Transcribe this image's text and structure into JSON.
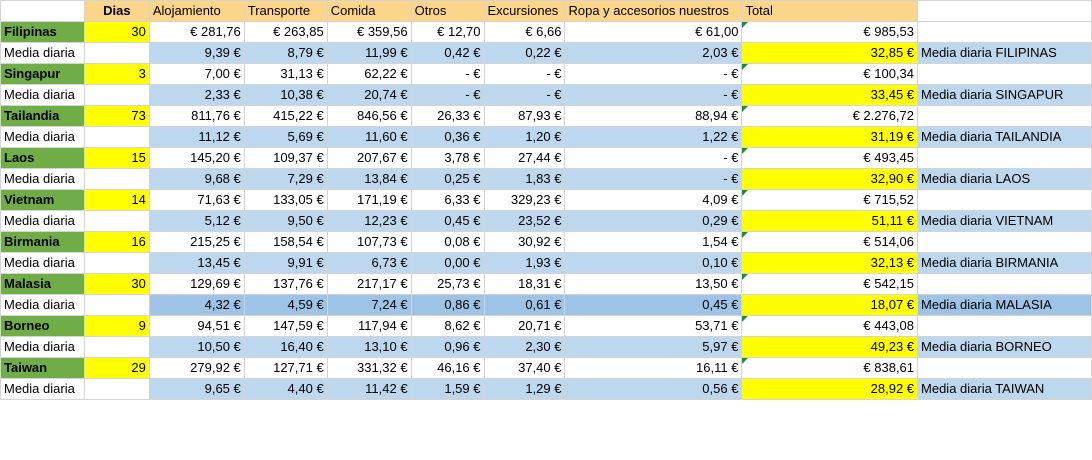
{
  "headers": {
    "col_country": "",
    "col_dias": "Dias",
    "col_alojamiento": "Alojamiento",
    "col_transporte": "Transporte",
    "col_comida": "Comida",
    "col_otros": "Otros",
    "col_excursiones": "Excursiones",
    "col_ropa": "Ropa y accesorios nuestros",
    "col_total": "Total"
  },
  "rows": [
    {
      "name": "Filipinas",
      "dias": "30",
      "aloj": "€ 281,76",
      "trans": "€ 263,85",
      "comida": "€ 359,56",
      "otros": "€ 12,70",
      "exc": "€ 6,66",
      "ropa": "€ 61,00",
      "total": "€ 985,53",
      "avg_label": "Media diaria",
      "avg_aloj": "9,39 €",
      "avg_trans": "8,79 €",
      "avg_comida": "11,99 €",
      "avg_otros": "0,42 €",
      "avg_exc": "0,22 €",
      "avg_ropa": "2,03 €",
      "avg_total": "32,85 €",
      "avg_name": "Media diaria FILIPINAS"
    },
    {
      "name": "Singapur",
      "dias": "3",
      "aloj": "7,00 €",
      "trans": "31,13 €",
      "comida": "62,22 €",
      "otros": "-    €",
      "exc": "-    €",
      "ropa": "-    €",
      "total": "€ 100,34",
      "avg_label": "Media diaria",
      "avg_aloj": "2,33 €",
      "avg_trans": "10,38 €",
      "avg_comida": "20,74 €",
      "avg_otros": "-    €",
      "avg_exc": "-    €",
      "avg_ropa": "-    €",
      "avg_total": "33,45 €",
      "avg_name": "Media diaria SINGAPUR"
    },
    {
      "name": "Tailandia",
      "dias": "73",
      "aloj": "811,76 €",
      "trans": "415,22 €",
      "comida": "846,56 €",
      "otros": "26,33 €",
      "exc": "87,93 €",
      "ropa": "88,94 €",
      "total": "€ 2.276,72",
      "avg_label": "Media diaria",
      "avg_aloj": "11,12 €",
      "avg_trans": "5,69 €",
      "avg_comida": "11,60 €",
      "avg_otros": "0,36 €",
      "avg_exc": "1,20 €",
      "avg_ropa": "1,22 €",
      "avg_total": "31,19 €",
      "avg_name": "Media diaria TAILANDIA"
    },
    {
      "name": "Laos",
      "dias": "15",
      "aloj": "145,20 €",
      "trans": "109,37 €",
      "comida": "207,67 €",
      "otros": "3,78 €",
      "exc": "27,44 €",
      "ropa": "-    €",
      "total": "€ 493,45",
      "avg_label": "Media diaria",
      "avg_aloj": "9,68 €",
      "avg_trans": "7,29 €",
      "avg_comida": "13,84 €",
      "avg_otros": "0,25 €",
      "avg_exc": "1,83 €",
      "avg_ropa": "-    €",
      "avg_total": "32,90 €",
      "avg_name": "Media diaria LAOS"
    },
    {
      "name": "Vietnam",
      "dias": "14",
      "aloj": "71,63 €",
      "trans": "133,05 €",
      "comida": "171,19 €",
      "otros": "6,33 €",
      "exc": "329,23 €",
      "ropa": "4,09 €",
      "total": "€ 715,52",
      "avg_label": "Media diaria",
      "avg_aloj": "5,12 €",
      "avg_trans": "9,50 €",
      "avg_comida": "12,23 €",
      "avg_otros": "0,45 €",
      "avg_exc": "23,52 €",
      "avg_ropa": "0,29 €",
      "avg_total": "51,11 €",
      "avg_name": "Media diaria VIETNAM"
    },
    {
      "name": "Birmania",
      "dias": "16",
      "aloj": "215,25 €",
      "trans": "158,54 €",
      "comida": "107,73 €",
      "otros": "0,08 €",
      "exc": "30,92 €",
      "ropa": "1,54 €",
      "total": "€ 514,06",
      "avg_label": "Media diaria",
      "avg_aloj": "13,45 €",
      "avg_trans": "9,91 €",
      "avg_comida": "6,73 €",
      "avg_otros": "0,00 €",
      "avg_exc": "1,93 €",
      "avg_ropa": "0,10 €",
      "avg_total": "32,13 €",
      "avg_name": "Media diaria BIRMANIA"
    },
    {
      "name": "Malasia",
      "dias": "30",
      "aloj": "129,69 €",
      "trans": "137,76 €",
      "comida": "217,17 €",
      "otros": "25,73 €",
      "exc": "18,31 €",
      "ropa": "13,50 €",
      "total": "€ 542,15",
      "avg_label": "Media diaria",
      "avg_aloj": "4,32 €",
      "avg_trans": "4,59 €",
      "avg_comida": "7,24 €",
      "avg_otros": "0,86 €",
      "avg_exc": "0,61 €",
      "avg_ropa": "0,45 €",
      "avg_total": "18,07 €",
      "avg_name": "Media diaria MALASIA"
    },
    {
      "name": "Borneo",
      "dias": "9",
      "aloj": "94,51 €",
      "trans": "147,59 €",
      "comida": "117,94 €",
      "otros": "8,62 €",
      "exc": "20,71 €",
      "ropa": "53,71 €",
      "total": "€ 443,08",
      "avg_label": "Media diaria",
      "avg_aloj": "10,50 €",
      "avg_trans": "16,40 €",
      "avg_comida": "13,10 €",
      "avg_otros": "0,96 €",
      "avg_exc": "2,30 €",
      "avg_ropa": "5,97 €",
      "avg_total": "49,23 €",
      "avg_name": "Media diaria BORNEO"
    },
    {
      "name": "Taiwan",
      "dias": "29",
      "aloj": "279,92 €",
      "trans": "127,71 €",
      "comida": "331,32 €",
      "otros": "46,16 €",
      "exc": "37,40 €",
      "ropa": "16,11 €",
      "total": "€ 838,61",
      "avg_label": "Media diaria",
      "avg_aloj": "9,65 €",
      "avg_trans": "4,40 €",
      "avg_comida": "11,42 €",
      "avg_otros": "1,59 €",
      "avg_exc": "1,29 €",
      "avg_ropa": "0,56 €",
      "avg_total": "28,92 €",
      "avg_name": "Media diaria TAIWAN"
    }
  ],
  "colors": {
    "header": "#fbd58a",
    "country": "#70ad47",
    "dias": "#ffff00",
    "avg_band": "#bdd7ee",
    "avg_band_dark": "#9dc3e6",
    "total_highlight": "#ffff00"
  }
}
